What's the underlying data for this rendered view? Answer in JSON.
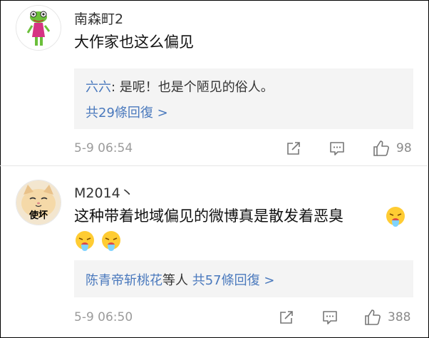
{
  "comments": [
    {
      "username": "南森町2",
      "text": "大作家也这么偏见",
      "reply": {
        "author": "六六",
        "separator": ": ",
        "text": "是呢！也是个陋见的俗人。",
        "more": "共29條回復 >"
      },
      "time": "5-9 06:54",
      "likes": "98",
      "icons": {
        "share": "share-icon",
        "comment": "comment-icon",
        "like": "thumbs-up-icon"
      }
    },
    {
      "username": "M2014丶",
      "avatar_label": "使坏",
      "text": "这种带着地域偏见的微博真是散发着恶臭",
      "reply": {
        "author": "陈青帝斩桃花",
        "suffix": "等人",
        "more": "共57條回復 >"
      },
      "time": "5-9 06:50",
      "likes": "388",
      "icons": {
        "share": "share-icon",
        "comment": "comment-icon",
        "like": "thumbs-up-icon"
      }
    }
  ],
  "colors": {
    "link": "#4a79bd",
    "meta": "#9b9b9b",
    "reply_bg": "#f4f4f4"
  }
}
